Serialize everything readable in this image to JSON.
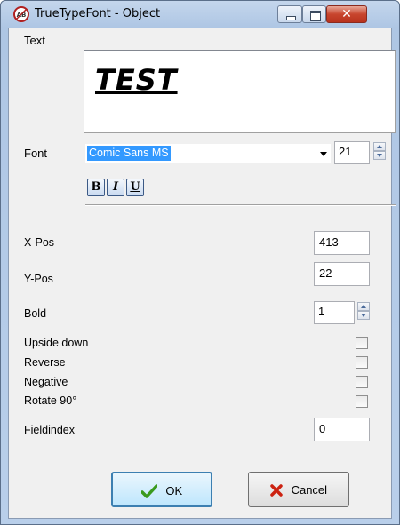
{
  "window": {
    "title": "TrueTypeFont - Object",
    "close_glyph": "✕",
    "app_icon": "truetypefont-app-icon"
  },
  "text_field": {
    "label": "Text",
    "preview_text": "TEST"
  },
  "font": {
    "label": "Font",
    "selected": "Comic Sans MS",
    "size": "21",
    "bold_label": "B",
    "italic_label": "I",
    "underline_label": "U"
  },
  "position": {
    "x_label": "X-Pos",
    "x_value": "413",
    "y_label": "Y-Pos",
    "y_value": "22"
  },
  "bold": {
    "label": "Bold",
    "value": "1"
  },
  "options": [
    {
      "label": "Upside down",
      "checked": false
    },
    {
      "label": "Reverse",
      "checked": false
    },
    {
      "label": "Negative",
      "checked": false
    },
    {
      "label": "Rotate 90°",
      "checked": false
    }
  ],
  "fieldindex": {
    "label": "Fieldindex",
    "value": "0"
  },
  "buttons": {
    "ok_label": "OK",
    "cancel_label": "Cancel"
  },
  "colors": {
    "selection_blue": "#3399ff",
    "ok_check_green": "#3a9a1e",
    "cancel_x_red": "#cc2211",
    "close_red": "#c8452e"
  }
}
